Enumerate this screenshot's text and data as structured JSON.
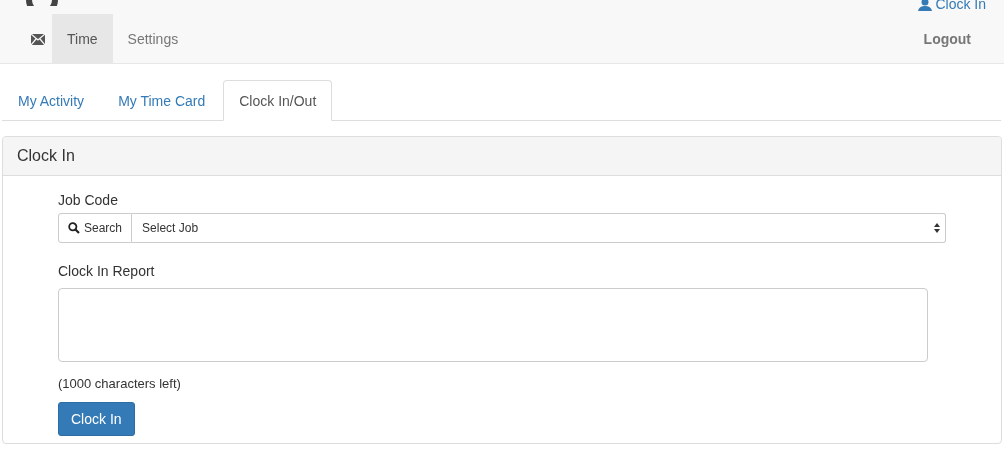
{
  "navbar": {
    "user_link": "Clock In",
    "items": [
      {
        "kind": "icon",
        "selected": false
      },
      {
        "kind": "text",
        "label": "Time",
        "selected": true
      },
      {
        "kind": "text",
        "label": "Settings",
        "selected": false
      }
    ],
    "logout": "Logout"
  },
  "tabs": [
    {
      "label": "My Activity",
      "selected": false
    },
    {
      "label": "My Time Card",
      "selected": false
    },
    {
      "label": "Clock In/Out",
      "selected": true
    }
  ],
  "panel": {
    "title": "Clock In",
    "job_label": "Job Code",
    "search_button": "Search",
    "job_select": "Select Job",
    "report_label": "Clock In Report",
    "chars_left": "(1000 characters left)",
    "submit": "Clock In"
  }
}
